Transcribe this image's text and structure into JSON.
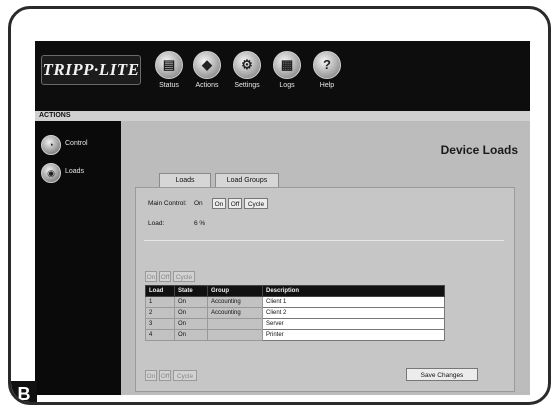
{
  "header": {
    "logo_text": "TRIPP·LITE",
    "nav": [
      {
        "label": "Status",
        "icon": "status-icon",
        "glyph": "▤"
      },
      {
        "label": "Actions",
        "icon": "actions-icon",
        "glyph": "◆"
      },
      {
        "label": "Settings",
        "icon": "settings-icon",
        "glyph": "⚙"
      },
      {
        "label": "Logs",
        "icon": "logs-icon",
        "glyph": "▦"
      },
      {
        "label": "Help",
        "icon": "help-icon",
        "glyph": "?"
      }
    ]
  },
  "section_label": "ACTIONS",
  "sidebar": {
    "items": [
      {
        "label": "Control",
        "icon": "control-icon",
        "glyph": "◔"
      },
      {
        "label": "Loads",
        "icon": "loads-icon",
        "glyph": "◉"
      }
    ]
  },
  "main": {
    "title": "Device Loads",
    "tabs": [
      {
        "label": "Loads"
      },
      {
        "label": "Load Groups"
      }
    ],
    "main_control": {
      "label": "Main Control:",
      "state": "On",
      "buttons": [
        "On",
        "Off",
        "Cycle"
      ]
    },
    "load": {
      "label": "Load:",
      "value": "6 %"
    },
    "bulk_buttons": [
      "On",
      "Off",
      "Cycle"
    ],
    "table": {
      "headers": [
        "Load",
        "State",
        "Group",
        "Description"
      ],
      "rows": [
        {
          "load": "1",
          "state": "On",
          "group": "Accounting",
          "description": "Client 1"
        },
        {
          "load": "2",
          "state": "On",
          "group": "Accounting",
          "description": "Client 2"
        },
        {
          "load": "3",
          "state": "On",
          "group": "",
          "description": "Server"
        },
        {
          "load": "4",
          "state": "On",
          "group": "",
          "description": "Printer"
        }
      ]
    },
    "bottom_buttons": [
      "On",
      "Off",
      "Cycle"
    ],
    "save_label": "Save Changes"
  },
  "figure_badge": "B"
}
